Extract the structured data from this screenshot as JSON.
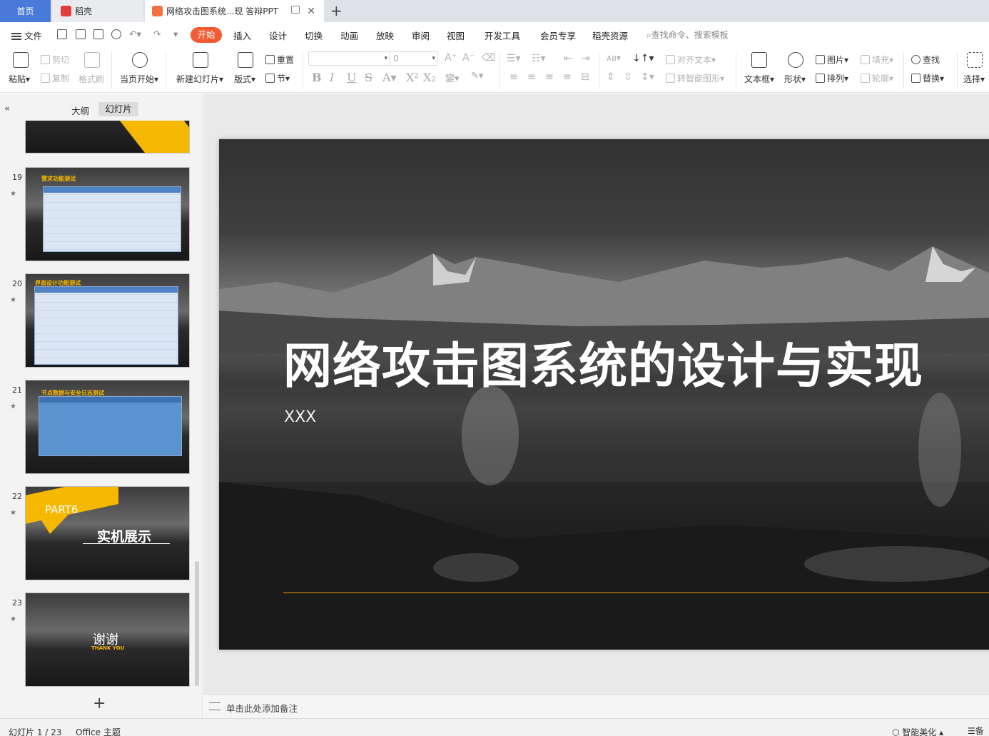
{
  "tabs": {
    "home": "首页",
    "daoke": "稻壳",
    "document": "网络攻击图系统...现 答辩PPT"
  },
  "menu": {
    "file": "文件",
    "start": "开始",
    "insert": "插入",
    "design": "设计",
    "transition": "切换",
    "animation": "动画",
    "slideshow": "放映",
    "review": "审阅",
    "view": "视图",
    "devtools": "开发工具",
    "member": "会员专享",
    "daoke_res": "稻壳资源",
    "search_placeholder": "查找命令、搜索模板"
  },
  "ribbon": {
    "paste": "粘贴",
    "cut": "剪切",
    "copy": "复制",
    "format_painter": "格式刷",
    "from_current": "当页开始",
    "new_slide": "新建幻灯片",
    "layout": "版式",
    "reset": "重置",
    "section": "节",
    "font_size": "0",
    "align_text": "对齐文本",
    "smart_shape": "转智能图形",
    "textbox": "文本框",
    "shape": "形状",
    "picture": "图片",
    "arrange": "排列",
    "fill": "填充",
    "outline": "轮廓",
    "find": "查找",
    "replace": "替换",
    "select": "选择"
  },
  "sidebar": {
    "outline_tab": "大纲",
    "slides_tab": "幻灯片",
    "thumbs": [
      {
        "num": "19",
        "title": "需求功能测试"
      },
      {
        "num": "20",
        "title": "界面设计功能测试"
      },
      {
        "num": "21",
        "title": "节点数据与安全日志测试"
      },
      {
        "num": "22",
        "part": "PART6",
        "title": "实机展示"
      },
      {
        "num": "23",
        "title": "谢谢",
        "subtitle": "THANK YOU"
      }
    ]
  },
  "slide": {
    "title": "网络攻击图系统的设计与实现",
    "subtitle": "XXX"
  },
  "notes_placeholder": "单击此处添加备注",
  "status": {
    "slide_count": "幻灯片 1 / 23",
    "theme": "Office 主题",
    "beautify": "智能美化",
    "notes": "备"
  },
  "colors": {
    "accent": "#f25b33",
    "home_tab": "#4a7ad9",
    "gold": "#f6b800"
  }
}
